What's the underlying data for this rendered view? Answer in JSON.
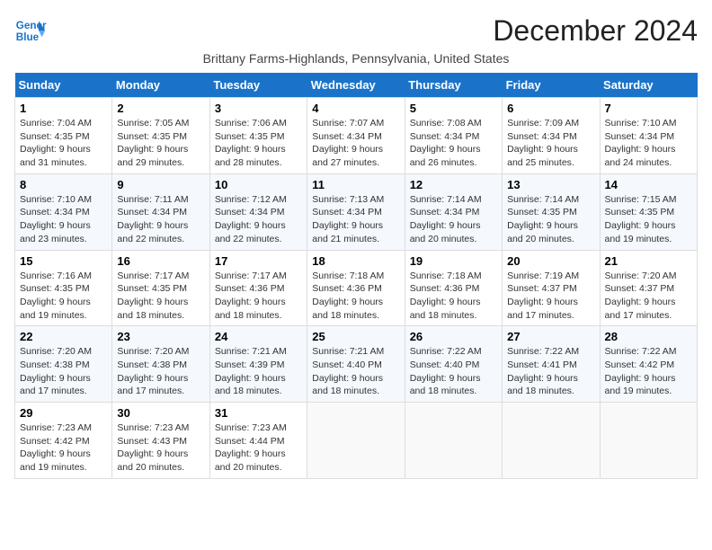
{
  "logo": {
    "line1": "General",
    "line2": "Blue"
  },
  "title": "December 2024",
  "subtitle": "Brittany Farms-Highlands, Pennsylvania, United States",
  "days_header": [
    "Sunday",
    "Monday",
    "Tuesday",
    "Wednesday",
    "Thursday",
    "Friday",
    "Saturday"
  ],
  "weeks": [
    [
      {
        "day": "1",
        "sunrise": "7:04 AM",
        "sunset": "4:35 PM",
        "daylight": "9 hours and 31 minutes."
      },
      {
        "day": "2",
        "sunrise": "7:05 AM",
        "sunset": "4:35 PM",
        "daylight": "9 hours and 29 minutes."
      },
      {
        "day": "3",
        "sunrise": "7:06 AM",
        "sunset": "4:35 PM",
        "daylight": "9 hours and 28 minutes."
      },
      {
        "day": "4",
        "sunrise": "7:07 AM",
        "sunset": "4:34 PM",
        "daylight": "9 hours and 27 minutes."
      },
      {
        "day": "5",
        "sunrise": "7:08 AM",
        "sunset": "4:34 PM",
        "daylight": "9 hours and 26 minutes."
      },
      {
        "day": "6",
        "sunrise": "7:09 AM",
        "sunset": "4:34 PM",
        "daylight": "9 hours and 25 minutes."
      },
      {
        "day": "7",
        "sunrise": "7:10 AM",
        "sunset": "4:34 PM",
        "daylight": "9 hours and 24 minutes."
      }
    ],
    [
      {
        "day": "8",
        "sunrise": "7:10 AM",
        "sunset": "4:34 PM",
        "daylight": "9 hours and 23 minutes."
      },
      {
        "day": "9",
        "sunrise": "7:11 AM",
        "sunset": "4:34 PM",
        "daylight": "9 hours and 22 minutes."
      },
      {
        "day": "10",
        "sunrise": "7:12 AM",
        "sunset": "4:34 PM",
        "daylight": "9 hours and 22 minutes."
      },
      {
        "day": "11",
        "sunrise": "7:13 AM",
        "sunset": "4:34 PM",
        "daylight": "9 hours and 21 minutes."
      },
      {
        "day": "12",
        "sunrise": "7:14 AM",
        "sunset": "4:34 PM",
        "daylight": "9 hours and 20 minutes."
      },
      {
        "day": "13",
        "sunrise": "7:14 AM",
        "sunset": "4:35 PM",
        "daylight": "9 hours and 20 minutes."
      },
      {
        "day": "14",
        "sunrise": "7:15 AM",
        "sunset": "4:35 PM",
        "daylight": "9 hours and 19 minutes."
      }
    ],
    [
      {
        "day": "15",
        "sunrise": "7:16 AM",
        "sunset": "4:35 PM",
        "daylight": "9 hours and 19 minutes."
      },
      {
        "day": "16",
        "sunrise": "7:17 AM",
        "sunset": "4:35 PM",
        "daylight": "9 hours and 18 minutes."
      },
      {
        "day": "17",
        "sunrise": "7:17 AM",
        "sunset": "4:36 PM",
        "daylight": "9 hours and 18 minutes."
      },
      {
        "day": "18",
        "sunrise": "7:18 AM",
        "sunset": "4:36 PM",
        "daylight": "9 hours and 18 minutes."
      },
      {
        "day": "19",
        "sunrise": "7:18 AM",
        "sunset": "4:36 PM",
        "daylight": "9 hours and 18 minutes."
      },
      {
        "day": "20",
        "sunrise": "7:19 AM",
        "sunset": "4:37 PM",
        "daylight": "9 hours and 17 minutes."
      },
      {
        "day": "21",
        "sunrise": "7:20 AM",
        "sunset": "4:37 PM",
        "daylight": "9 hours and 17 minutes."
      }
    ],
    [
      {
        "day": "22",
        "sunrise": "7:20 AM",
        "sunset": "4:38 PM",
        "daylight": "9 hours and 17 minutes."
      },
      {
        "day": "23",
        "sunrise": "7:20 AM",
        "sunset": "4:38 PM",
        "daylight": "9 hours and 17 minutes."
      },
      {
        "day": "24",
        "sunrise": "7:21 AM",
        "sunset": "4:39 PM",
        "daylight": "9 hours and 18 minutes."
      },
      {
        "day": "25",
        "sunrise": "7:21 AM",
        "sunset": "4:40 PM",
        "daylight": "9 hours and 18 minutes."
      },
      {
        "day": "26",
        "sunrise": "7:22 AM",
        "sunset": "4:40 PM",
        "daylight": "9 hours and 18 minutes."
      },
      {
        "day": "27",
        "sunrise": "7:22 AM",
        "sunset": "4:41 PM",
        "daylight": "9 hours and 18 minutes."
      },
      {
        "day": "28",
        "sunrise": "7:22 AM",
        "sunset": "4:42 PM",
        "daylight": "9 hours and 19 minutes."
      }
    ],
    [
      {
        "day": "29",
        "sunrise": "7:23 AM",
        "sunset": "4:42 PM",
        "daylight": "9 hours and 19 minutes."
      },
      {
        "day": "30",
        "sunrise": "7:23 AM",
        "sunset": "4:43 PM",
        "daylight": "9 hours and 20 minutes."
      },
      {
        "day": "31",
        "sunrise": "7:23 AM",
        "sunset": "4:44 PM",
        "daylight": "9 hours and 20 minutes."
      },
      null,
      null,
      null,
      null
    ]
  ]
}
